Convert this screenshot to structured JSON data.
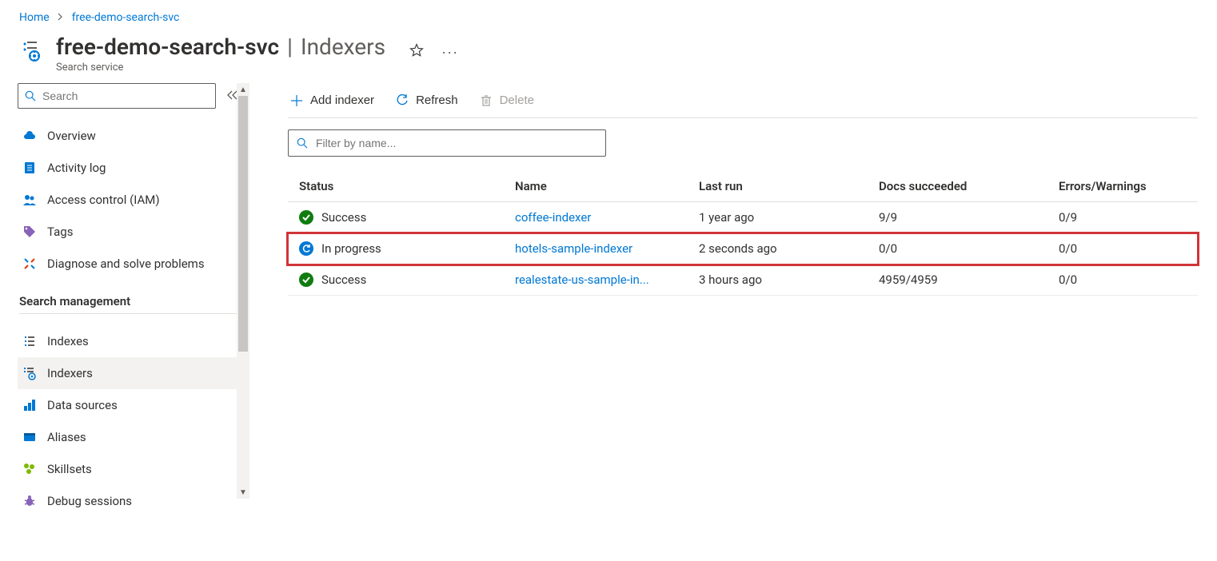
{
  "breadcrumb": {
    "home": "Home",
    "resource": "free-demo-search-svc"
  },
  "header": {
    "resource_name": "free-demo-search-svc",
    "blade_name": "Indexers",
    "subtitle": "Search service"
  },
  "sidebar": {
    "search_placeholder": "Search",
    "items_top": [
      {
        "label": "Overview",
        "icon": "cloud"
      },
      {
        "label": "Activity log",
        "icon": "log"
      },
      {
        "label": "Access control (IAM)",
        "icon": "people"
      },
      {
        "label": "Tags",
        "icon": "tag"
      },
      {
        "label": "Diagnose and solve problems",
        "icon": "wrench"
      }
    ],
    "section_label": "Search management",
    "items_mgmt": [
      {
        "label": "Indexes",
        "icon": "list"
      },
      {
        "label": "Indexers",
        "icon": "indexer",
        "selected": true
      },
      {
        "label": "Data sources",
        "icon": "datasource"
      },
      {
        "label": "Aliases",
        "icon": "alias"
      },
      {
        "label": "Skillsets",
        "icon": "skillset"
      },
      {
        "label": "Debug sessions",
        "icon": "bug"
      }
    ]
  },
  "toolbar": {
    "add_label": "Add indexer",
    "refresh_label": "Refresh",
    "delete_label": "Delete"
  },
  "filter": {
    "placeholder": "Filter by name..."
  },
  "table": {
    "columns": {
      "status": "Status",
      "name": "Name",
      "last_run": "Last run",
      "docs": "Docs succeeded",
      "errors": "Errors/Warnings"
    },
    "rows": [
      {
        "status": "Success",
        "status_kind": "success",
        "name": "coffee-indexer",
        "last_run": "1 year ago",
        "docs": "9/9",
        "errors": "0/9",
        "highlighted": false
      },
      {
        "status": "In progress",
        "status_kind": "progress",
        "name": "hotels-sample-indexer",
        "last_run": "2 seconds ago",
        "docs": "0/0",
        "errors": "0/0",
        "highlighted": true
      },
      {
        "status": "Success",
        "status_kind": "success",
        "name": "realestate-us-sample-in...",
        "last_run": "3 hours ago",
        "docs": "4959/4959",
        "errors": "0/0",
        "highlighted": false
      }
    ]
  }
}
